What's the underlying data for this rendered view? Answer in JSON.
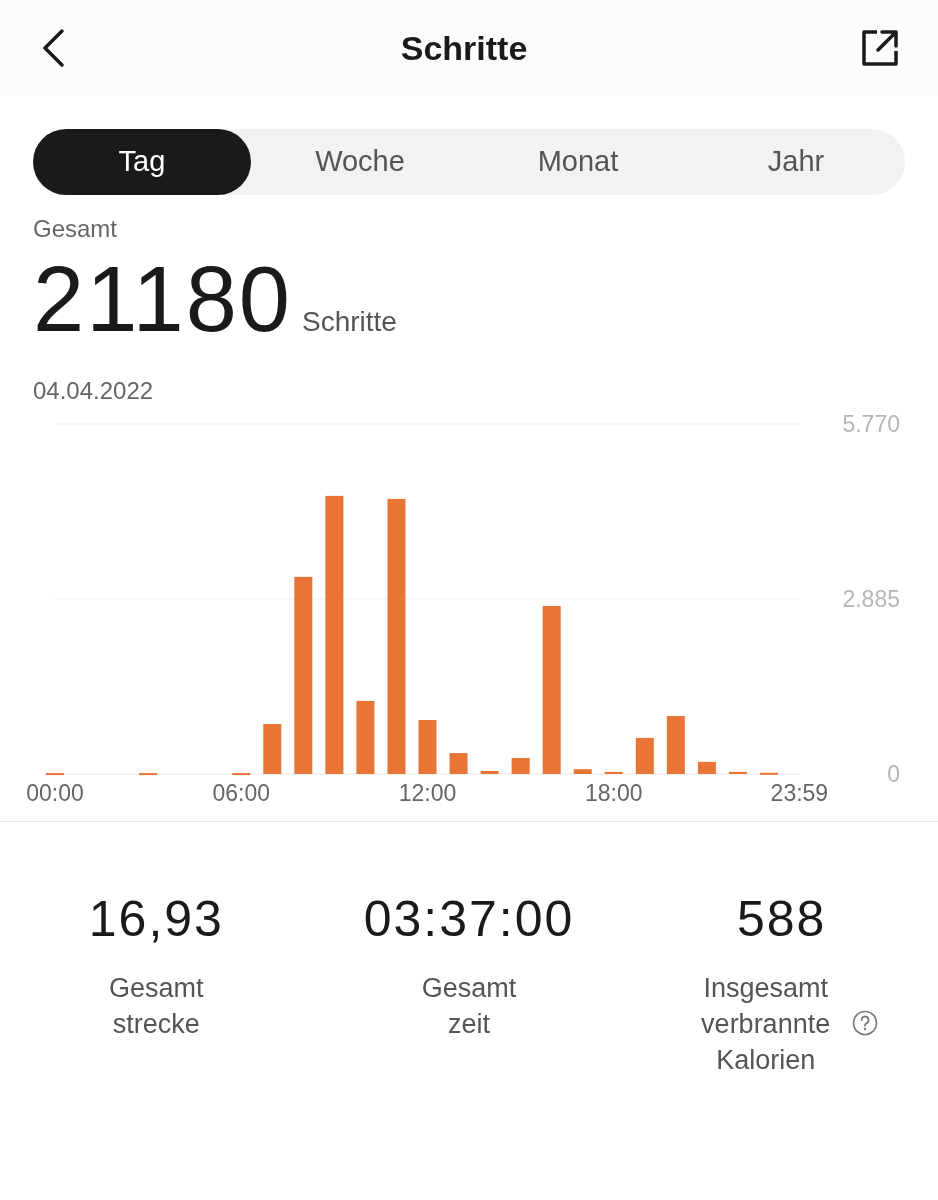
{
  "header": {
    "title": "Schritte"
  },
  "tabs": [
    {
      "label": "Tag",
      "selected": true
    },
    {
      "label": "Woche",
      "selected": false
    },
    {
      "label": "Monat",
      "selected": false
    },
    {
      "label": "Jahr",
      "selected": false
    }
  ],
  "summary": {
    "label": "Gesamt",
    "value": "21180",
    "unit": "Schritte",
    "date": "04.04.2022"
  },
  "chart_data": {
    "type": "bar",
    "x": [
      0,
      1,
      2,
      3,
      4,
      5,
      6,
      7,
      8,
      9,
      10,
      11,
      12,
      13,
      14,
      15,
      16,
      17,
      18,
      19,
      20,
      21,
      22,
      23
    ],
    "series": [
      {
        "color": "#e87435",
        "values": [
          15,
          0,
          0,
          15,
          0,
          0,
          15,
          825,
          3250,
          4585,
          1205,
          4535,
          890,
          345,
          50,
          265,
          2770,
          80,
          35,
          595,
          955,
          200,
          35,
          20
        ]
      }
    ],
    "xlim": [
      0,
      24
    ],
    "ylim": [
      0,
      5770
    ],
    "yticks": [
      {
        "value": 0,
        "label": "0"
      },
      {
        "value": 2885,
        "label": "2.885"
      },
      {
        "value": 5770,
        "label": "5.770"
      }
    ],
    "xticks": [
      {
        "value": 0,
        "label": "00:00"
      },
      {
        "value": 6,
        "label": "06:00"
      },
      {
        "value": 12,
        "label": "12:00"
      },
      {
        "value": 18,
        "label": "18:00"
      },
      {
        "value": 23.98,
        "label": "23:59"
      }
    ]
  },
  "stats": [
    {
      "value": "16,93",
      "label": "Gesamt strecke",
      "help": false
    },
    {
      "value": "03:37:00",
      "label": "Gesamt zeit",
      "help": false
    },
    {
      "value": "588",
      "label": "Insgesamt verbrannte Kalorien",
      "help": true
    }
  ]
}
